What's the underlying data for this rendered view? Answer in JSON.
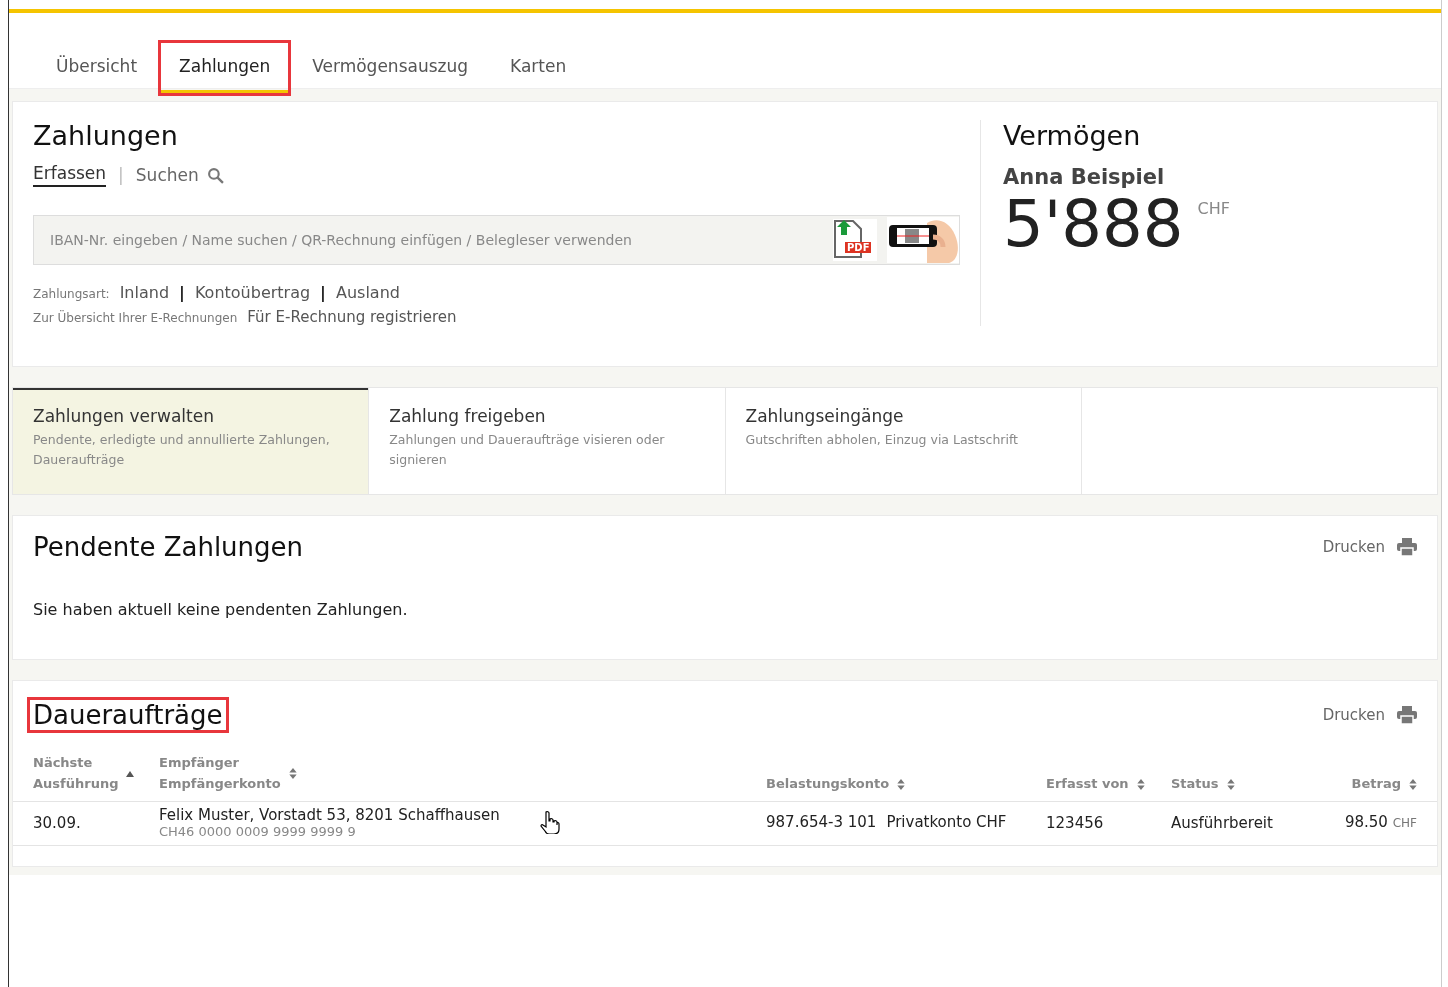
{
  "tabs": [
    {
      "label": "Übersicht",
      "selected": false,
      "highlighted": false
    },
    {
      "label": "Zahlungen",
      "selected": true,
      "highlighted": true
    },
    {
      "label": "Vermögensauszug",
      "selected": false,
      "highlighted": false
    },
    {
      "label": "Karten",
      "selected": false,
      "highlighted": false
    }
  ],
  "payments": {
    "title": "Zahlungen",
    "modes": [
      {
        "label": "Erfassen",
        "selected": true
      },
      {
        "label": "Suchen",
        "selected": false
      }
    ],
    "separator": "|",
    "search": {
      "placeholder": "IBAN-Nr. eingeben / Name suchen / QR-Rechnung einfügen / Belegleser verwenden",
      "pdf_badge": "PDF"
    },
    "payment_type_label": "Zahlungsart:",
    "payment_types": [
      "Inland",
      "Kontoübertrag",
      "Ausland"
    ],
    "ebill_label": "Zur Übersicht Ihrer E-Rechnungen",
    "ebill_link": "Für E-Rechnung registrieren"
  },
  "assets": {
    "title": "Vermögen",
    "owner": "Anna Beispiel",
    "amount": "5'888",
    "currency": "CHF"
  },
  "actions": [
    {
      "title": "Zahlungen verwalten",
      "subtitle": "Pendente, erledigte und annullierte Zahlungen, Daueraufträge",
      "selected": true
    },
    {
      "title": "Zahlung freigeben",
      "subtitle": "Zahlungen und Daueraufträge visieren oder signieren",
      "selected": false
    },
    {
      "title": "Zahlungseingänge",
      "subtitle": "Gutschriften abholen, Einzug via Lastschrift",
      "selected": false
    }
  ],
  "pending": {
    "title": "Pendente Zahlungen",
    "print": "Drucken",
    "message": "Sie haben aktuell keine pendenten Zahlungen."
  },
  "standing_orders": {
    "title": "Daueraufträge",
    "highlighted": true,
    "print": "Drucken",
    "columns": [
      {
        "label": "Nächste",
        "label2": "Ausführung",
        "sorted_ascending": true
      },
      {
        "label": "Empfänger",
        "label2": "Empfängerkonto",
        "sorted_ascending": false
      },
      {
        "label": "Belastungskonto",
        "sorted_ascending": false
      },
      {
        "label": "Erfasst von",
        "sorted_ascending": false
      },
      {
        "label": "Status",
        "sorted_ascending": false
      },
      {
        "label": "Betrag",
        "sorted_ascending": false
      }
    ],
    "rows": [
      {
        "date": "30.09.",
        "recipient": "Felix Muster, Vorstadt 53, 8201 Schaffhausen",
        "recipient_account": "CH46 0000 0009 9999 9999 9",
        "account_number": "987.654-3 101",
        "account_name": "Privatkonto CHF",
        "created_by": "123456",
        "status": "Ausführbereit",
        "amount": "98.50",
        "currency": "CHF"
      }
    ]
  }
}
